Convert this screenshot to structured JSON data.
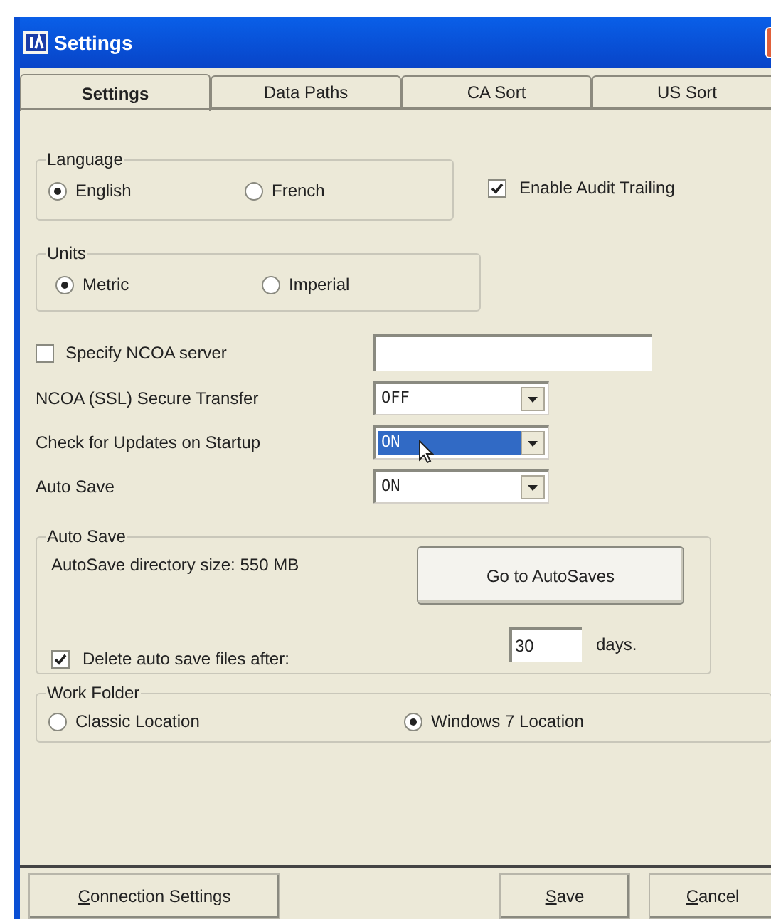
{
  "window": {
    "title": "Settings"
  },
  "tabs": [
    {
      "label": "Settings",
      "selected": true
    },
    {
      "label": "Data Paths",
      "selected": false
    },
    {
      "label": "CA Sort",
      "selected": false
    },
    {
      "label": "US Sort",
      "selected": false
    }
  ],
  "language": {
    "title": "Language",
    "options": [
      {
        "label": "English",
        "selected": true
      },
      {
        "label": "French",
        "selected": false
      }
    ]
  },
  "audit_trailing": {
    "label": "Enable Audit Trailing",
    "checked": true
  },
  "units": {
    "title": "Units",
    "options": [
      {
        "label": "Metric",
        "selected": true
      },
      {
        "label": "Imperial",
        "selected": false
      }
    ]
  },
  "ncoa_server": {
    "label": "Specify NCOA server",
    "checked": false
  },
  "dropdowns": [
    {
      "label": "NCOA (SSL) Secure Transfer",
      "value": "OFF",
      "selected": false
    },
    {
      "label": "Check for Updates on Startup",
      "value": "ON",
      "selected": true
    },
    {
      "label": "Auto Save",
      "value": "ON",
      "selected": false
    }
  ],
  "auto_save": {
    "title": "Auto Save",
    "directory_size": "AutoSave directory size: 550 MB",
    "button": "Go to AutoSaves",
    "delete_label": "Delete auto save files after:",
    "delete_checked": true,
    "days_value": "30",
    "days_unit": "days."
  },
  "work_folder": {
    "title": "Work Folder",
    "options": [
      {
        "label": "Classic Location",
        "selected": false
      },
      {
        "label": "Windows 7 Location",
        "selected": true
      }
    ]
  },
  "buttons": [
    {
      "label": "Connection Settings"
    },
    {
      "label": "Save"
    },
    {
      "label": "Cancel"
    }
  ]
}
